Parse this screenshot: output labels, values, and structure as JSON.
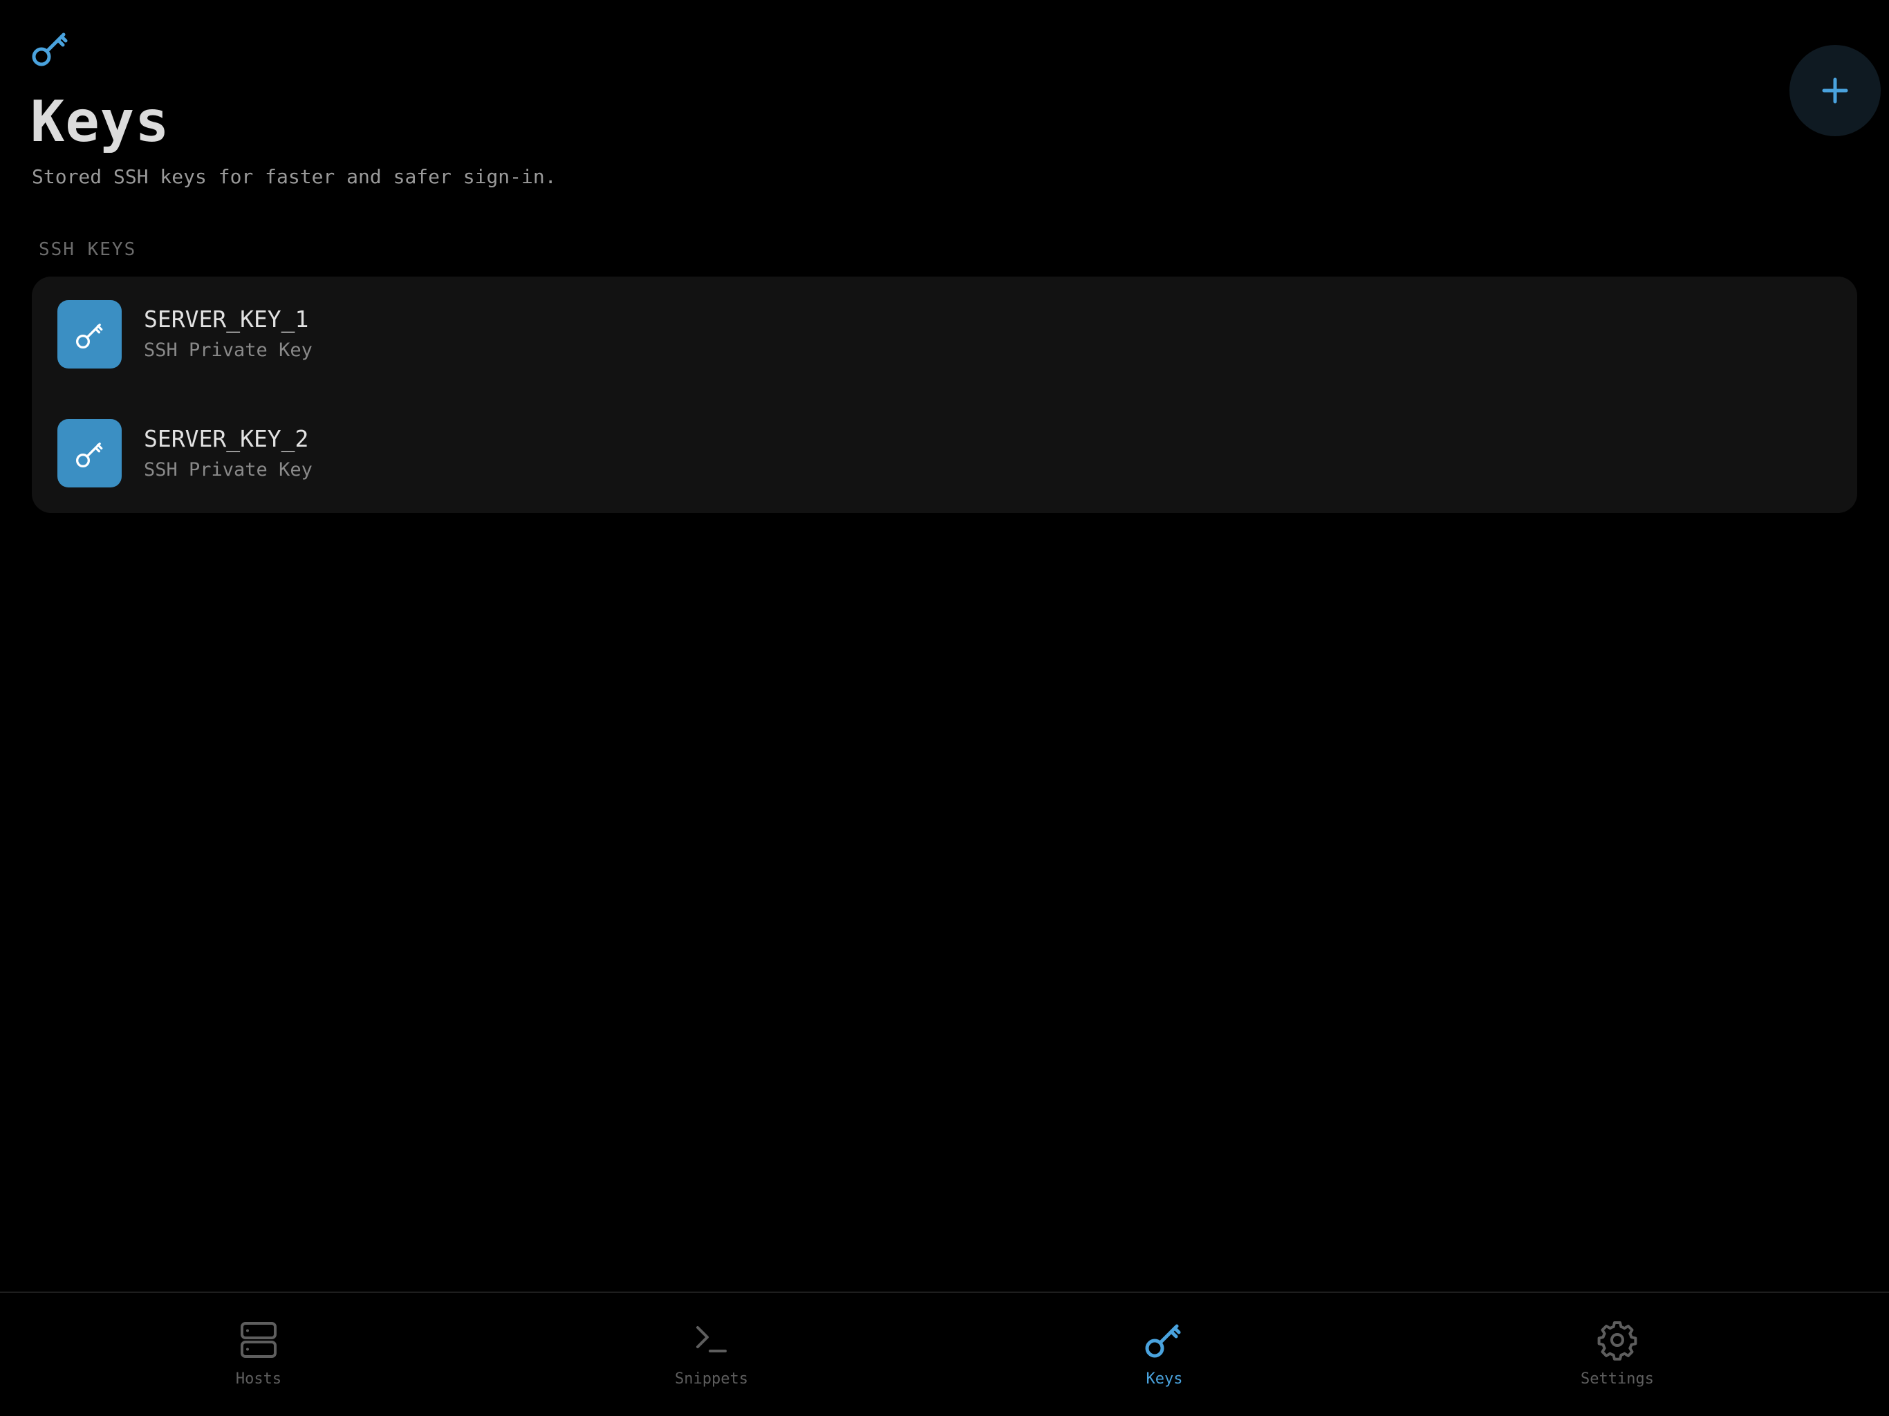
{
  "header": {
    "title": "Keys",
    "subtitle": "Stored SSH keys for faster and safer sign-in.",
    "icon": "key-icon",
    "add_button_icon": "plus-icon"
  },
  "section": {
    "label": "SSH KEYS"
  },
  "keys": [
    {
      "name": "SERVER_KEY_1",
      "type": "SSH Private Key",
      "icon": "key-icon"
    },
    {
      "name": "SERVER_KEY_2",
      "type": "SSH Private Key",
      "icon": "key-icon"
    }
  ],
  "tabbar": {
    "tabs": [
      {
        "label": "Hosts",
        "icon": "server-icon",
        "active": false
      },
      {
        "label": "Snippets",
        "icon": "terminal-icon",
        "active": false
      },
      {
        "label": "Keys",
        "icon": "key-icon",
        "active": true
      },
      {
        "label": "Settings",
        "icon": "gear-icon",
        "active": false
      }
    ]
  },
  "colors": {
    "background": "#000000",
    "accent": "#4aa3de",
    "key_tile": "#3b8fc3",
    "card": "#121212",
    "inactive_tab": "#5e5e5e"
  }
}
